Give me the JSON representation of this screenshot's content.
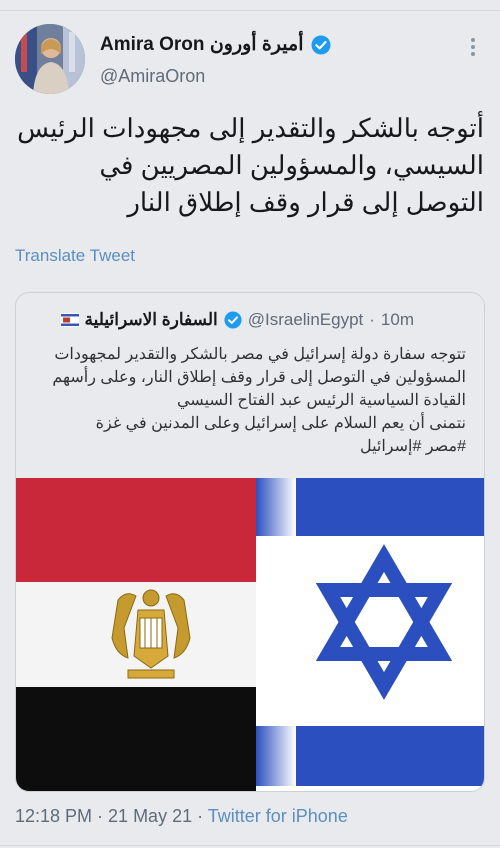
{
  "tweet": {
    "display_name": "Amira Oron أميرة أورون",
    "handle": "@AmiraOron",
    "text": "أتوجه بالشكر والتقدير إلى مجهودات الرئيس السيسي، والمسؤولين المصريين في التوصل إلى قرار وقف إطلاق النار",
    "translate_label": "Translate Tweet",
    "timestamp": "12:18 PM · 21 May 21 · ",
    "source": "Twitter for iPhone"
  },
  "quoted": {
    "display_name": "السفارة الاسرائيلية",
    "handle": "@IsraelinEgypt",
    "separator": "·",
    "time": "10m",
    "text_lines": [
      "تتوجه سفارة دولة إسرائيل في مصر بالشكر والتقدير لمجهودات",
      "المسؤولين في التوصل إلى قرار وقف إطلاق النار، وعلى رأسهم",
      "القيادة السياسية الرئيس عبد الفتاح السيسي",
      "نتمنى أن يعم السلام على إسرائيل وعلى المدنين في غزة",
      "#مصر #إسرائيل"
    ]
  },
  "colors": {
    "accent": "#1d9bf0",
    "link": "#5b8fbf",
    "egypt_red": "#ce1126",
    "egypt_black": "#000000",
    "israel_blue": "#0038b8",
    "eagle_gold": "#c09300"
  }
}
